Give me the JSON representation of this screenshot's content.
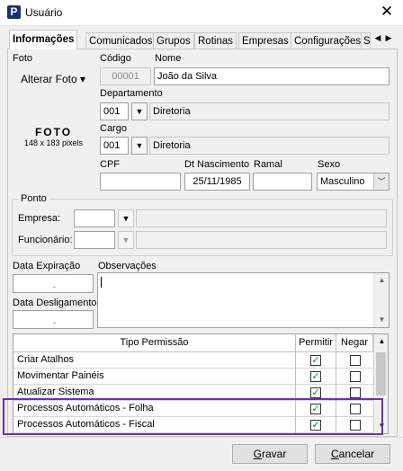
{
  "window": {
    "title": "Usuário",
    "app_icon_letter": "P",
    "close_glyph": "✕"
  },
  "tabs": [
    {
      "label": "Informações"
    },
    {
      "label": "Comunicados"
    },
    {
      "label": "Grupos"
    },
    {
      "label": "Rotinas"
    },
    {
      "label": "Empresas"
    },
    {
      "label": "Configurações"
    },
    {
      "label": "S"
    }
  ],
  "photo": {
    "label": "Foto",
    "button_label": "Alterar Foto ▾",
    "placeholder_title": "FOTO",
    "placeholder_size": "148 x 183 pixels"
  },
  "user": {
    "codigo_label": "Código",
    "codigo_value": "00001",
    "nome_label": "Nome",
    "nome_value": "João da Silva",
    "departamento_label": "Departamento",
    "departamento_code": "001",
    "departamento_name": "Diretoria",
    "cargo_label": "Cargo",
    "cargo_code": "001",
    "cargo_name": "Diretoria",
    "cpf_label": "CPF",
    "cpf_value": "",
    "nascimento_label": "Dt Nascimento",
    "nascimento_value": "25/11/1985",
    "ramal_label": "Ramal",
    "ramal_value": "",
    "sexo_label": "Sexo",
    "sexo_value": "Masculino"
  },
  "ponto": {
    "legend": "Ponto",
    "empresa_label": "Empresa:",
    "funcionario_label": "Funcionário:"
  },
  "dates": {
    "expiracao_label": "Data Expiração",
    "desligamento_label": "Data Desligamento",
    "observacoes_label": "Observações"
  },
  "permissions": {
    "headers": {
      "tipo": "Tipo Permissão",
      "permitir": "Permitir",
      "negar": "Negar"
    },
    "rows": [
      {
        "label": "Criar Atalhos",
        "permitir": true,
        "negar": false
      },
      {
        "label": "Movimentar Painéis",
        "permitir": true,
        "negar": false
      },
      {
        "label": "Atualizar Sistema",
        "permitir": true,
        "negar": false
      },
      {
        "label": "Processos Automáticos - Folha",
        "permitir": true,
        "negar": false
      },
      {
        "label": "Processos Automáticos - Fiscal",
        "permitir": true,
        "negar": false
      }
    ]
  },
  "buttons": {
    "gravar_first": "G",
    "gravar_rest": "ravar",
    "cancelar_first": "C",
    "cancelar_rest": "ancelar"
  },
  "colors": {
    "highlight": "#7030a0",
    "check": "#1a8a2a",
    "required_mark": "#e02020"
  }
}
